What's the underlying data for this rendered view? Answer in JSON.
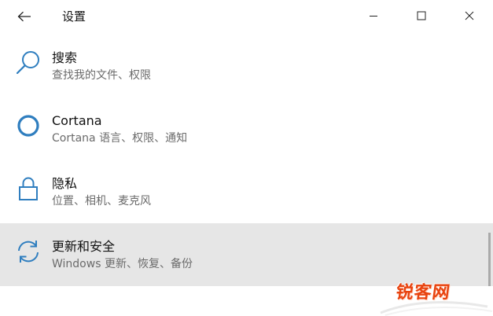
{
  "window": {
    "title": "设置"
  },
  "items": [
    {
      "label": "搜索",
      "desc": "查找我的文件、权限",
      "icon": "search-icon"
    },
    {
      "label": "Cortana",
      "desc": "Cortana 语言、权限、通知",
      "icon": "cortana-icon"
    },
    {
      "label": "隐私",
      "desc": "位置、相机、麦克风",
      "icon": "lock-icon"
    },
    {
      "label": "更新和安全",
      "desc": "Windows 更新、恢复、备份",
      "icon": "sync-icon",
      "selected": true
    }
  ],
  "watermark": {
    "text": "锐客网"
  },
  "colors": {
    "accent": "#2f7ebf",
    "selected_bg": "#e6e6e6",
    "watermark": "#e8430f"
  }
}
